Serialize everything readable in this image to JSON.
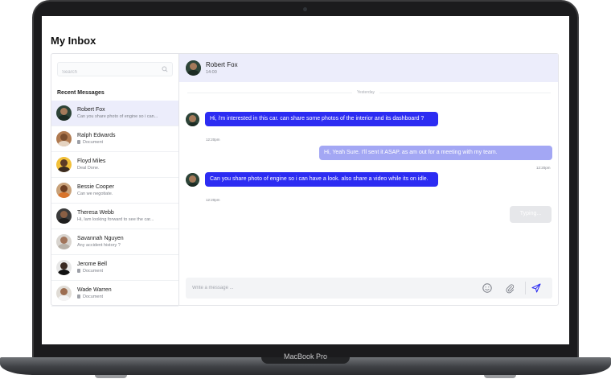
{
  "device": {
    "brand": "MacBook Pro"
  },
  "app": {
    "title": "My Inbox"
  },
  "search": {
    "placeholder": "Search"
  },
  "sidebar": {
    "section_title": "Recent Messages",
    "contacts": [
      {
        "name": "Robert Fox",
        "preview": "Can you share photo of engine so i can...",
        "active": true,
        "attachment": false
      },
      {
        "name": "Ralph Edwards",
        "preview": "Document",
        "active": false,
        "attachment": true
      },
      {
        "name": "Floyd Miles",
        "preview": "Deal Done.",
        "active": false,
        "attachment": false
      },
      {
        "name": "Bessie Cooper",
        "preview": "Can we negotiate.",
        "active": false,
        "attachment": false
      },
      {
        "name": "Theresa Webb",
        "preview": "Hi, Iam looking forward to see the car...",
        "active": false,
        "attachment": false
      },
      {
        "name": "Savannah Nguyen",
        "preview": "Any accident history ?",
        "active": false,
        "attachment": false
      },
      {
        "name": "Jerome Bell",
        "preview": "Document",
        "active": false,
        "attachment": true
      },
      {
        "name": "Wade Warren",
        "preview": "Document",
        "active": false,
        "attachment": true
      }
    ]
  },
  "chat": {
    "header": {
      "name": "Robert Fox",
      "time": "14:00"
    },
    "day_label": "Yesterday",
    "messages": [
      {
        "direction": "in",
        "text": "Hi, i'm interested in this car. can share some photos of the interior and its dashboard ?",
        "time": "12:20pm"
      },
      {
        "direction": "out",
        "text": "Hi, Yeah Sure. I'll sent it ASAP. as am out for a meeting with my team.",
        "time": "12:20pm"
      },
      {
        "direction": "in",
        "text": "Can you share photo of engine so i can have a look. also share a video while its on idle.",
        "time": "12:20pm"
      }
    ],
    "typing_label": "Typing..."
  },
  "composer": {
    "placeholder": "Write a message ...",
    "icons": [
      "emoji-icon",
      "paperclip-icon",
      "send-icon"
    ]
  },
  "colors": {
    "accent": "#2c2cf2",
    "outgoing_bubble": "#a3a7f4",
    "active_row": "#ecedfb"
  }
}
